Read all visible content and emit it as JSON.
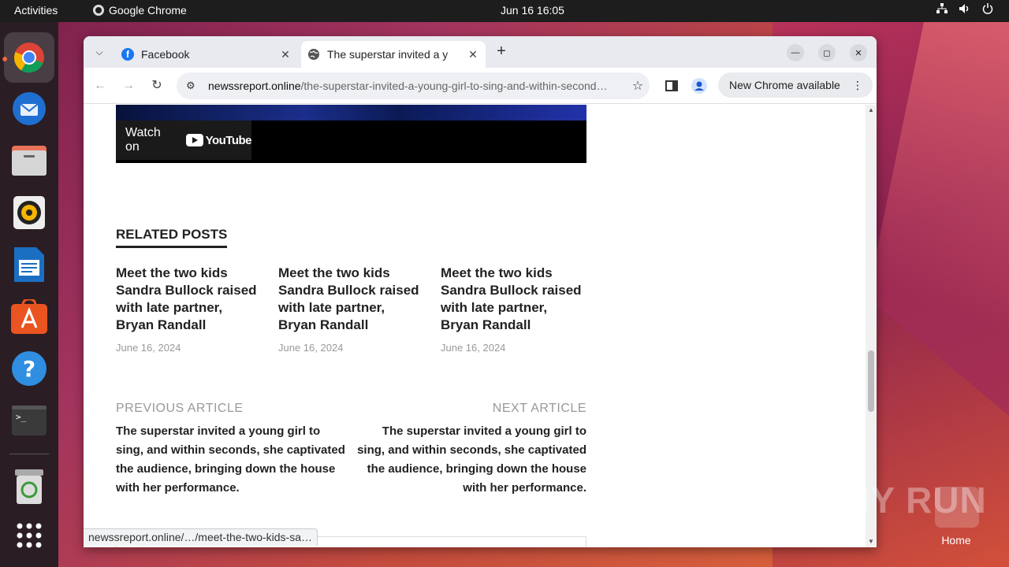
{
  "topbar": {
    "activities": "Activities",
    "app_name": "Google Chrome",
    "clock": "Jun 16  16:05"
  },
  "dock": {
    "items": [
      "chrome-icon",
      "thunderbird-icon",
      "files-icon",
      "rhythmbox-icon",
      "writer-icon",
      "app-center-icon",
      "help-icon",
      "terminal-icon",
      "trash-icon",
      "app-grid-icon"
    ]
  },
  "browser": {
    "tabs": [
      {
        "title": "Facebook"
      },
      {
        "title": "The superstar invited a y"
      }
    ],
    "url_domain": "newssreport.online",
    "url_path": "/the-superstar-invited-a-young-girl-to-sing-and-within-second…",
    "update_label": "New Chrome available"
  },
  "video": {
    "watch_on": "Watch on",
    "youtube": "YouTube"
  },
  "related": {
    "heading": "RELATED POSTS",
    "posts": [
      {
        "title": "Meet the two kids Sandra Bullock raised with late partner, Bryan Randall",
        "date": "June 16, 2024"
      },
      {
        "title": "Meet the two kids Sandra Bullock raised with late partner, Bryan Randall",
        "date": "June 16, 2024"
      },
      {
        "title": "Meet the two kids Sandra Bullock raised with late partner, Bryan Randall",
        "date": "June 16, 2024"
      }
    ]
  },
  "article_nav": {
    "prev_label": "PREVIOUS ARTICLE",
    "prev_title": "The superstar invited a young girl to sing, and within seconds, she captivated the audience, bringing down the house with her performance.",
    "next_label": "NEXT ARTICLE",
    "next_title": "The superstar invited a young girl to sing, and within seconds, she captivated the audience, bringing down the house with her performance."
  },
  "status_url": "newssreport.online/…/meet-the-two-kids-sa…",
  "desktop": {
    "watermark": "ANY RUN",
    "home_label": "Home"
  },
  "colors": {
    "ubuntu_orange": "#e95420",
    "facebook_blue": "#1877f2"
  }
}
